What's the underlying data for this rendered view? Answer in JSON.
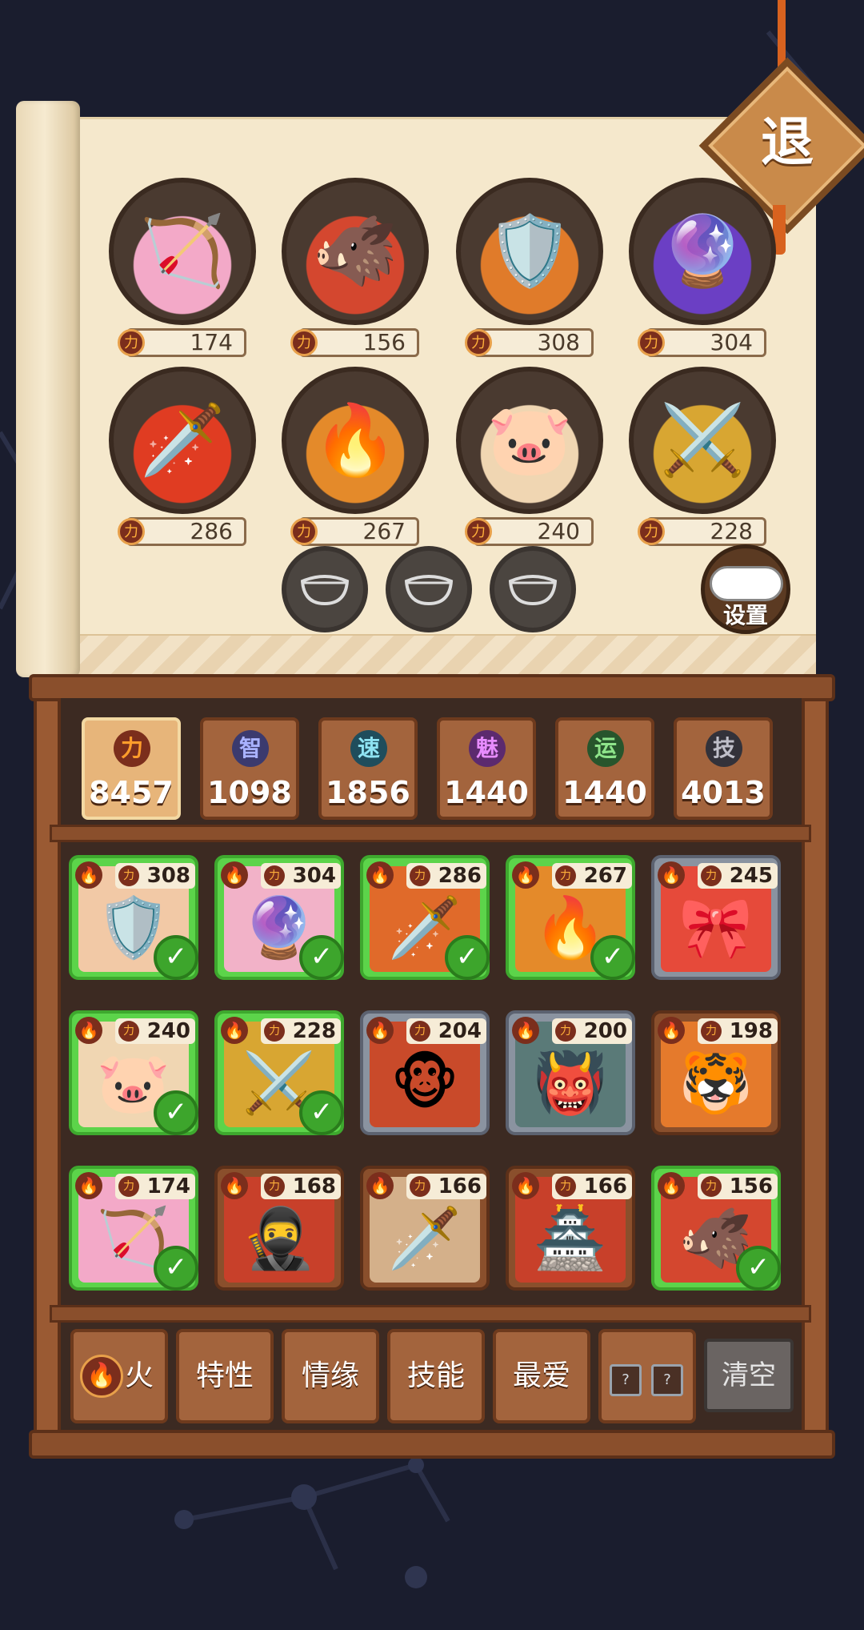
{
  "exit_label": "退",
  "team": [
    {
      "power": "174",
      "emoji": "🏹",
      "bg": "#f3a9c8"
    },
    {
      "power": "156",
      "emoji": "🐗",
      "bg": "#d4472f"
    },
    {
      "power": "308",
      "emoji": "🛡️",
      "bg": "#e07b2a"
    },
    {
      "power": "304",
      "emoji": "🔮",
      "bg": "#6b3fc4"
    },
    {
      "power": "286",
      "emoji": "🗡️",
      "bg": "#e03c22"
    },
    {
      "power": "267",
      "emoji": "🔥",
      "bg": "#e48a2a"
    },
    {
      "power": "240",
      "emoji": "🐷",
      "bg": "#f0d6b2"
    },
    {
      "power": "228",
      "emoji": "⚔️",
      "bg": "#d8a632"
    }
  ],
  "settings_label": "设置",
  "attributes": [
    {
      "icon": "力",
      "value": "8457",
      "icon_bg": "#7b2e1c",
      "icon_color": "#ff9d2b"
    },
    {
      "icon": "智",
      "value": "1098",
      "icon_bg": "#3b3a6e",
      "icon_color": "#a9b2ff"
    },
    {
      "icon": "速",
      "value": "1856",
      "icon_bg": "#1f4d5c",
      "icon_color": "#8fe3f2"
    },
    {
      "icon": "魅",
      "value": "1440",
      "icon_bg": "#5c2a6e",
      "icon_color": "#e78cff"
    },
    {
      "icon": "运",
      "value": "1440",
      "icon_bg": "#27552c",
      "icon_color": "#8ee38a"
    },
    {
      "icon": "技",
      "value": "4013",
      "icon_bg": "#33323a",
      "icon_color": "#bfbfc9"
    }
  ],
  "heroes": [
    {
      "power": "308",
      "selected": true,
      "emoji": "🛡️",
      "bg": "#f2c9a6"
    },
    {
      "power": "304",
      "selected": true,
      "emoji": "🔮",
      "bg": "#f2b2c8"
    },
    {
      "power": "286",
      "selected": true,
      "emoji": "🗡️",
      "bg": "#e06a2a"
    },
    {
      "power": "267",
      "selected": true,
      "emoji": "🔥",
      "bg": "#e48a2a"
    },
    {
      "power": "245",
      "selected": false,
      "emoji": "🎀",
      "bg": "#e64a3a"
    },
    {
      "power": "240",
      "selected": true,
      "emoji": "🐷",
      "bg": "#f0d6b2"
    },
    {
      "power": "228",
      "selected": true,
      "emoji": "⚔️",
      "bg": "#d8a632"
    },
    {
      "power": "204",
      "selected": false,
      "emoji": "🐵",
      "bg": "#c94a2a"
    },
    {
      "power": "200",
      "selected": false,
      "emoji": "👹",
      "bg": "#5a7a78"
    },
    {
      "power": "198",
      "selected": false,
      "emoji": "🐯",
      "bg": "#e57a2c"
    },
    {
      "power": "174",
      "selected": true,
      "emoji": "🏹",
      "bg": "#f3a9c8"
    },
    {
      "power": "168",
      "selected": false,
      "emoji": "🥷",
      "bg": "#c8402a"
    },
    {
      "power": "166",
      "selected": false,
      "emoji": "🗡️",
      "bg": "#d4b08a"
    },
    {
      "power": "166",
      "selected": false,
      "emoji": "🏯",
      "bg": "#c8402a"
    },
    {
      "power": "156",
      "selected": true,
      "emoji": "🐗",
      "bg": "#d4472f"
    }
  ],
  "filters": {
    "element": "火",
    "trait": "特性",
    "bond": "情缘",
    "skill": "技能",
    "favorite": "最爱",
    "unknown1": "?",
    "unknown2": "?",
    "clear": "清空"
  }
}
